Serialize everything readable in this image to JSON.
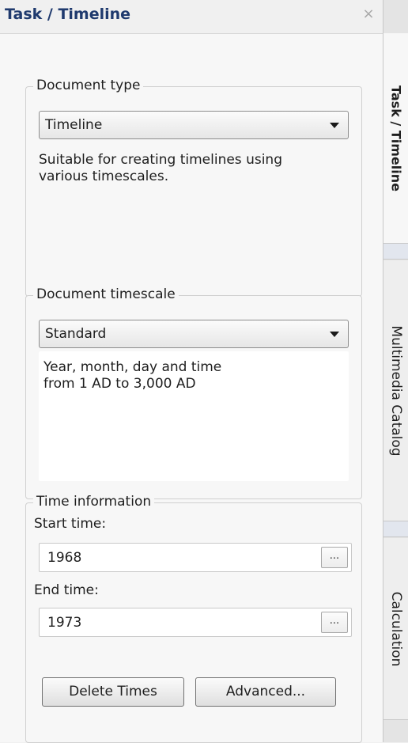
{
  "panel": {
    "title": "Task / Timeline",
    "close_symbol": "×"
  },
  "document_type": {
    "legend": "Document type",
    "selected": "Timeline",
    "description": "Suitable for creating timelines using\nvarious timescales."
  },
  "document_timescale": {
    "legend": "Document timescale",
    "selected": "Standard",
    "description": "Year, month, day and time\nfrom 1 AD to 3,000 AD"
  },
  "time_information": {
    "legend": "Time information",
    "start_label": "Start time:",
    "start_value": "1968",
    "end_label": "End time:",
    "end_value": "1973",
    "browse_label": "...",
    "delete_button": "Delete Times",
    "advanced_button": "Advanced..."
  },
  "tabs": [
    {
      "label": "Task / Timeline",
      "active": true
    },
    {
      "label": "Multimedia Catalog",
      "active": false
    },
    {
      "label": "Calculation",
      "active": false
    }
  ],
  "icons": {
    "close": "close-icon",
    "dropdown": "chevron-down-icon",
    "browse": "ellipsis-icon"
  },
  "colors": {
    "title": "#1f3a6e",
    "panel_bg": "#f7f7f7",
    "chrome_bg": "#f0f0f0"
  }
}
